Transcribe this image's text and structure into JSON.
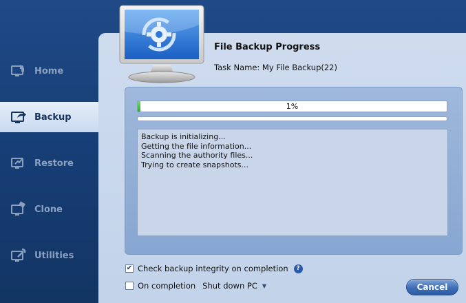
{
  "sidebar": {
    "items": [
      {
        "label": "Home",
        "icon": "home-icon",
        "active": false
      },
      {
        "label": "Backup",
        "icon": "backup-icon",
        "active": true
      },
      {
        "label": "Restore",
        "icon": "restore-icon",
        "active": false
      },
      {
        "label": "Clone",
        "icon": "clone-icon",
        "active": false
      },
      {
        "label": "Utilities",
        "icon": "utilities-icon",
        "active": false
      }
    ]
  },
  "header": {
    "title": "File Backup Progress",
    "task_name": "Task Name: My File Backup(22)",
    "icon": "monitor-gear-icon"
  },
  "progress": {
    "percent": 1,
    "label": "1%"
  },
  "log": {
    "lines": [
      "Backup is initializing...",
      "Getting the file information...",
      "Scanning the authority files...",
      "Trying to create snapshots..."
    ]
  },
  "options": {
    "integrity": {
      "label": "Check backup integrity on completion",
      "checked": true
    },
    "on_completion": {
      "label": "On completion",
      "checked": false,
      "selected": "Shut down PC"
    }
  },
  "buttons": {
    "cancel": "Cancel"
  },
  "colors": {
    "background": "#1f4a86",
    "panel": "#cfdcee",
    "accent": "#2c5ba3",
    "progress_fill": "#2ea82e"
  }
}
